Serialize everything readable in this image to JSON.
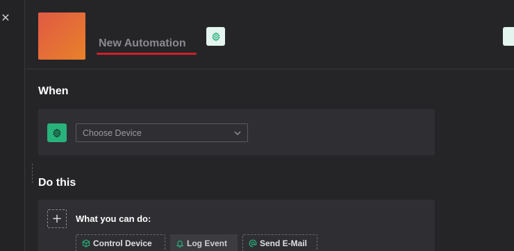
{
  "header": {
    "automation_name_placeholder": "New Automation"
  },
  "when": {
    "title": "When",
    "device_select_placeholder": "Choose Device"
  },
  "do_this": {
    "title": "Do this",
    "prompt": "What you can do:",
    "actions": [
      {
        "label": "Control Device",
        "icon": "cube-icon"
      },
      {
        "label": "Log Event",
        "icon": "bell-icon"
      },
      {
        "label": "Send E-Mail",
        "icon": "at-sign-icon"
      }
    ]
  },
  "colors": {
    "accent_green": "#29b27c",
    "error_underline": "#d0202a",
    "icon_gradient_start": "#e05a44",
    "icon_gradient_end": "#e8812a"
  }
}
